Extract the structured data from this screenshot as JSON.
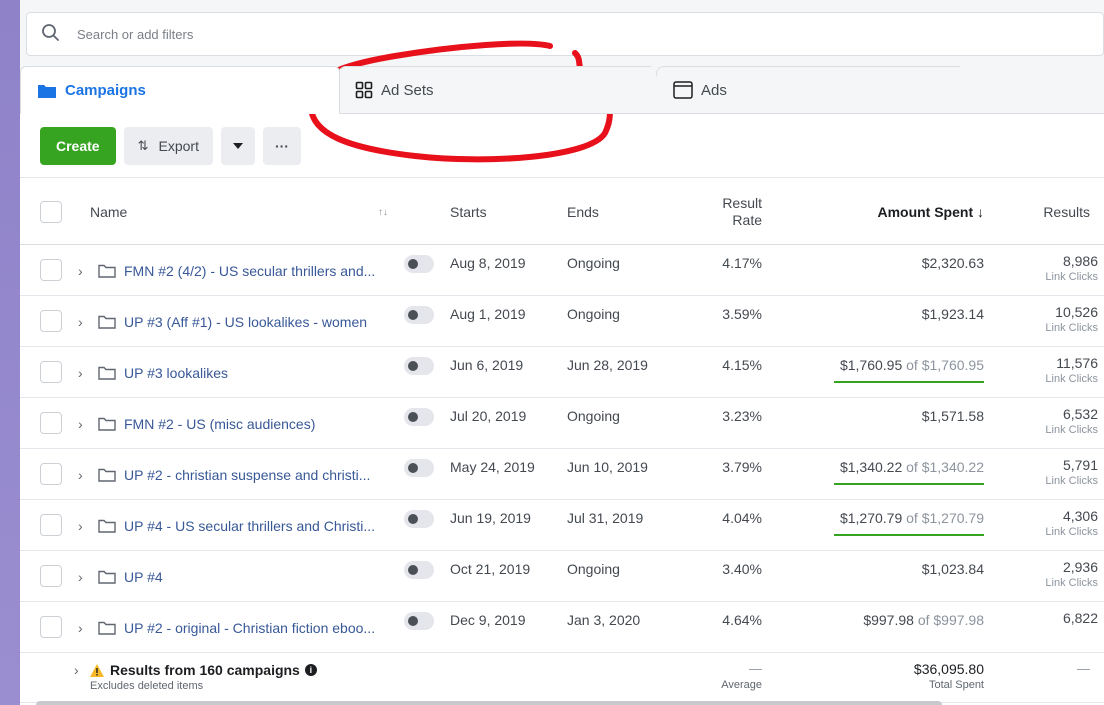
{
  "search": {
    "placeholder": "Search or add filters"
  },
  "tabs": [
    {
      "label": "Campaigns",
      "icon": "folder-icon",
      "active": true
    },
    {
      "label": "Ad Sets",
      "icon": "grid-icon",
      "active": false
    },
    {
      "label": "Ads",
      "icon": "window-icon",
      "active": false
    }
  ],
  "toolbar": {
    "create_label": "Create",
    "export_label": "Export",
    "more_label": "···"
  },
  "columns": {
    "name": "Name",
    "starts": "Starts",
    "ends": "Ends",
    "result_rate_1": "Result",
    "result_rate_2": "Rate",
    "amount_spent": "Amount Spent ↓",
    "results": "Results",
    "sort_icon": "↑↓"
  },
  "rows": [
    {
      "name": "FMN #2 (4/2) - US secular thrillers and...",
      "starts": "Aug 8, 2019",
      "ends": "Ongoing",
      "rate": "4.17%",
      "spent": "$2,320.63",
      "spent_of": "",
      "bar": false,
      "results": "8,986",
      "results_label": "Link Clicks"
    },
    {
      "name": "UP #3 (Aff #1) - US lookalikes - women",
      "starts": "Aug 1, 2019",
      "ends": "Ongoing",
      "rate": "3.59%",
      "spent": "$1,923.14",
      "spent_of": "",
      "bar": false,
      "results": "10,526",
      "results_label": "Link Clicks"
    },
    {
      "name": "UP #3 lookalikes",
      "starts": "Jun 6, 2019",
      "ends": "Jun 28, 2019",
      "rate": "4.15%",
      "spent": "$1,760.95",
      "spent_of": " of $1,760.95",
      "bar": true,
      "results": "11,576",
      "results_label": "Link Clicks"
    },
    {
      "name": "FMN #2 - US (misc audiences)",
      "starts": "Jul 20, 2019",
      "ends": "Ongoing",
      "rate": "3.23%",
      "spent": "$1,571.58",
      "spent_of": "",
      "bar": false,
      "results": "6,532",
      "results_label": "Link Clicks"
    },
    {
      "name": "UP #2 - christian suspense and christi...",
      "starts": "May 24, 2019",
      "ends": "Jun 10, 2019",
      "rate": "3.79%",
      "spent": "$1,340.22",
      "spent_of": " of $1,340.22",
      "bar": true,
      "results": "5,791",
      "results_label": "Link Clicks"
    },
    {
      "name": "UP #4 - US secular thrillers and Christi...",
      "starts": "Jun 19, 2019",
      "ends": "Jul 31, 2019",
      "rate": "4.04%",
      "spent": "$1,270.79",
      "spent_of": " of $1,270.79",
      "bar": true,
      "results": "4,306",
      "results_label": "Link Clicks"
    },
    {
      "name": "UP #4",
      "starts": "Oct 21, 2019",
      "ends": "Ongoing",
      "rate": "3.40%",
      "spent": "$1,023.84",
      "spent_of": "",
      "bar": false,
      "results": "2,936",
      "results_label": "Link Clicks"
    },
    {
      "name": "UP #2 - original - Christian fiction eboo...",
      "starts": "Dec 9, 2019",
      "ends": "Jan 3, 2020",
      "rate": "4.64%",
      "spent": "$997.98",
      "spent_of": " of $997.98",
      "bar": false,
      "results": "6,822",
      "results_label": ""
    }
  ],
  "summary": {
    "title": "Results from 160 campaigns",
    "subtitle": "Excludes deleted items",
    "rate_dash": "—",
    "rate_label": "Average",
    "spent": "$36,095.80",
    "spent_label": "Total Spent",
    "results_dash": "—"
  },
  "colors": {
    "create": "#36a420",
    "link": "#385898",
    "active_tab": "#1b74e4",
    "annotation": "#e8101a"
  }
}
